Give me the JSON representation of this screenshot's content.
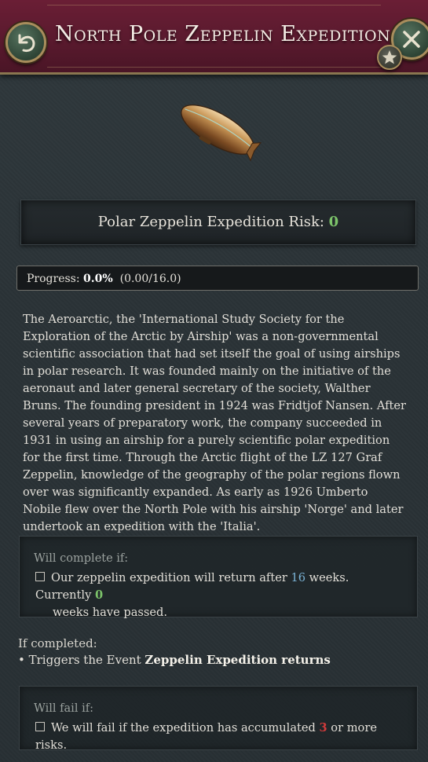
{
  "window": {
    "title": "North Pole Zeppelin Expedition"
  },
  "risk": {
    "label": "Polar Zeppelin Expedition Risk: ",
    "value": "0"
  },
  "progress": {
    "label": "Progress: ",
    "percent_text": "0.0%",
    "detail": "(0.00/16.0)",
    "fraction": 0.0
  },
  "description": "The Aeroarctic, the 'International Study Society for the Exploration of the Arctic by Airship' was a non-governmental scientific association that had set itself the goal of using airships in polar research. It was founded mainly on the initiative of the aeronaut and later general secretary of the society, Walther Bruns. The founding president in 1924 was Fridtjof Nansen. After several years of preparatory work, the company succeeded in 1931 in using an airship for a purely scientific polar expedition for the first time. Through the Arctic flight of the LZ 127 Graf Zeppelin, knowledge of the geography of the polar regions flown over was significantly expanded. As early as 1926 Umberto Nobile flew over the North Pole with his airship 'Norge' and later undertook an expedition with the 'Italia'.",
  "complete_condition": {
    "header": "Will complete if:",
    "text_a": "Our zeppelin expedition will return after ",
    "weeks": "16",
    "text_b": " weeks. Currently ",
    "current": "0",
    "text_c": "weeks have passed."
  },
  "if_completed": {
    "header": "If completed:",
    "prefix": "• Triggers the Event ",
    "event": "Zeppelin Expedition returns"
  },
  "fail_condition": {
    "header": "Will fail if:",
    "text_a": "We will fail if the expedition has accumulated ",
    "risk_limit": "3",
    "text_b": " or more risks."
  },
  "icons": {
    "back": "back-arrow-icon",
    "close": "close-icon",
    "star": "star-icon",
    "zeppelin": "zeppelin-icon"
  },
  "colors": {
    "header": "#5a1a2e",
    "positive": "#7cc36a",
    "negative": "#d23b3b",
    "highlight": "#7ab3d6"
  }
}
